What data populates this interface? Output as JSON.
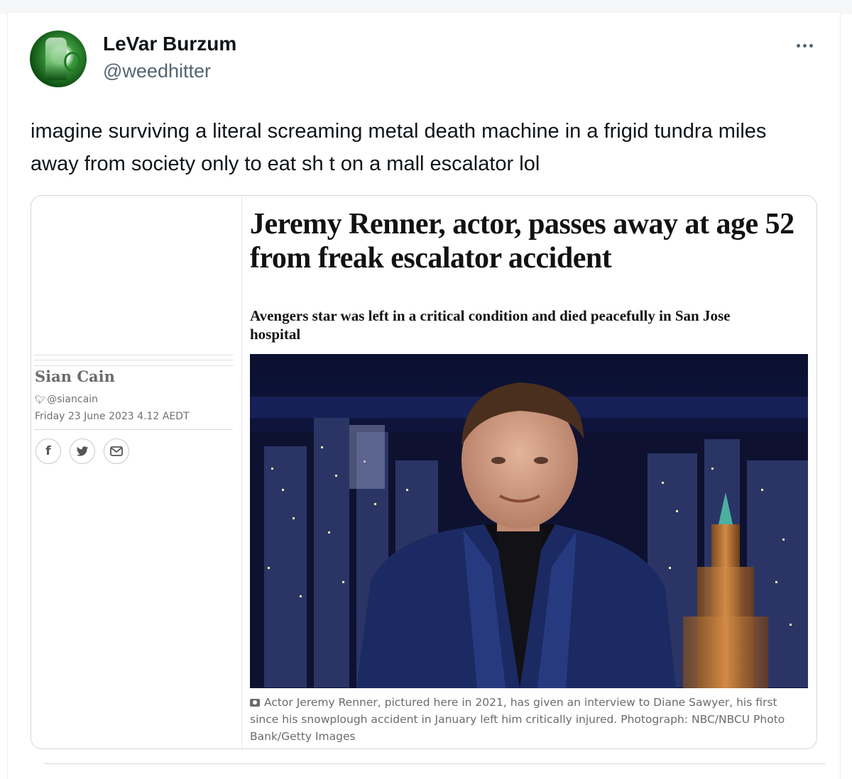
{
  "tweet": {
    "display_name": "LeVar Burzum",
    "handle": "@weedhitter",
    "text": "imagine surviving a literal screaming metal death machine in a frigid tundra miles away from society only to eat sh t on a mall escalator lol",
    "more_icon": "more-horizontal-icon"
  },
  "article": {
    "headline": "Jeremy Renner, actor, passes away at age 52 from freak escalator accident",
    "standfirst": "Avengers star was left in a critical condition and died peacefully in San Jose hospital",
    "author": "Sian Cain",
    "author_handle": "@siancain",
    "dateline": "Friday 23 June 2023 4.12 AEDT",
    "share": {
      "facebook": "f",
      "twitter": "twitter-bird-icon",
      "email": "email-icon"
    },
    "caption": "Actor Jeremy Renner, pictured here in 2021, has given an interview to Diane Sawyer, his first since his snowplough accident in January left him critically injured. Photograph: NBC/NBCU Photo Bank/Getty Images"
  },
  "colors": {
    "text_primary": "#0f1419",
    "text_secondary": "#536471",
    "card_border": "#cfd9de",
    "suit_blue": "#1c2a63",
    "night_sky": "#0a0f2a"
  }
}
